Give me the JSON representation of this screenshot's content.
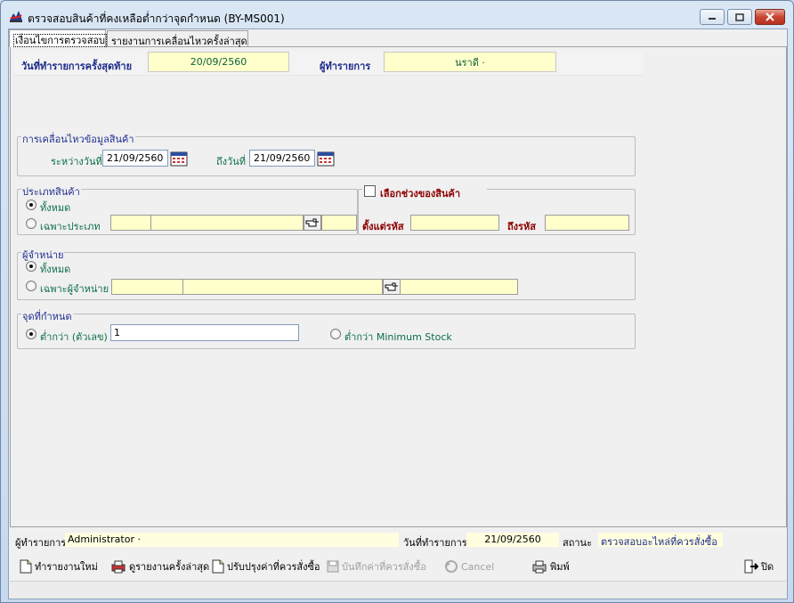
{
  "window": {
    "title": "ตรวจสอบสินค้าที่คงเหลือต่ำกว่าจุดกำหนด (BY-MS001)"
  },
  "tabs": [
    {
      "label": "เงื่อนไขการตรวจสอบ",
      "active": true
    },
    {
      "label": "รายงานการเคลื่อนไหวครั้งล่าสุด",
      "active": false
    }
  ],
  "header": {
    "last_date_label": "วันที่ทำรายการครั้งสุดท้าย",
    "last_date_value": "20/09/2560",
    "operator_label": "ผู้ทำรายการ",
    "operator_value": "นราดี ·"
  },
  "movement": {
    "title": "การเคลื่อนไหวข้อมูลสินค้า",
    "from_label": "ระหว่างวันที่",
    "from_value": "21/09/2560",
    "to_label": "ถึงวันที่",
    "to_value": "21/09/2560"
  },
  "product_type": {
    "title": "ประเภทสินค้า",
    "option_all": "ทั้งหมด",
    "option_specific": "เฉพาะประเภท",
    "selected": "all"
  },
  "product_range": {
    "checkbox_label": "เลือกช่วงของสินค้า",
    "checked": false,
    "from_label": "ตั้งแต่รหัส",
    "to_label": "ถึงรหัส"
  },
  "supplier": {
    "title": "ผู้จำหน่าย",
    "option_all": "ทั้งหมด",
    "option_specific": "เฉพาะผู้จำหน่าย",
    "selected": "all"
  },
  "threshold": {
    "title": "จุดที่กำหนด",
    "option_number": "ต่ำกว่า (ตัวเลข)",
    "number_value": "1",
    "option_min_stock": "ต่ำกว่า Minimum Stock",
    "selected": "number"
  },
  "status": {
    "operator_label": "ผู้ทำรายการ",
    "operator_value": "Administrator ·",
    "date_label": "วันที่ทำรายการ",
    "date_value": "21/09/2560",
    "state_label": "สถานะ",
    "state_value": "ตรวจสอบอะไหล่ที่ควรสั่งซื้อ"
  },
  "toolbar": {
    "new_label": "ทำรายงานใหม่",
    "view_last_label": "ดูรายงานครั้งล่าสุด",
    "update_label": "ปรับปรุงค่าที่ควรสั่งซื้อ",
    "save_label": "บันทึกค่าที่ควรสั่งซื้อ",
    "cancel_label": "Cancel",
    "print_label": "พิมพ์",
    "close_label": "ปิด"
  },
  "colors": {
    "accent_blue": "#1c2a8a",
    "green_text": "#0b6e48",
    "red_text": "#8b0000",
    "field_yellow": "#ffffcc"
  }
}
